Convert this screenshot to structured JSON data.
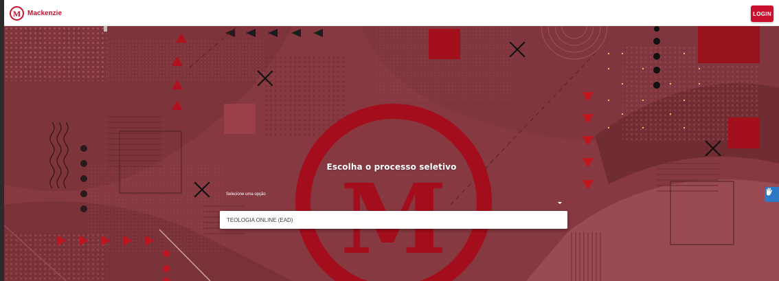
{
  "header": {
    "brand_name": "Mackenzie",
    "brand_letter": "M",
    "login_label": "LOGIN",
    "accent_color": "#c8102e"
  },
  "hero": {
    "title": "Escolha o processo seletivo",
    "big_logo_letter": "M",
    "select": {
      "label": "Selecione uma opção",
      "value": ""
    },
    "options": [
      "TEOLOGIA ONLINE (EAD)"
    ]
  },
  "icons": {
    "logo": "mackenzie-logo-icon",
    "dropdown": "chevron-down-icon",
    "accessibility": "sign-language-icon"
  }
}
